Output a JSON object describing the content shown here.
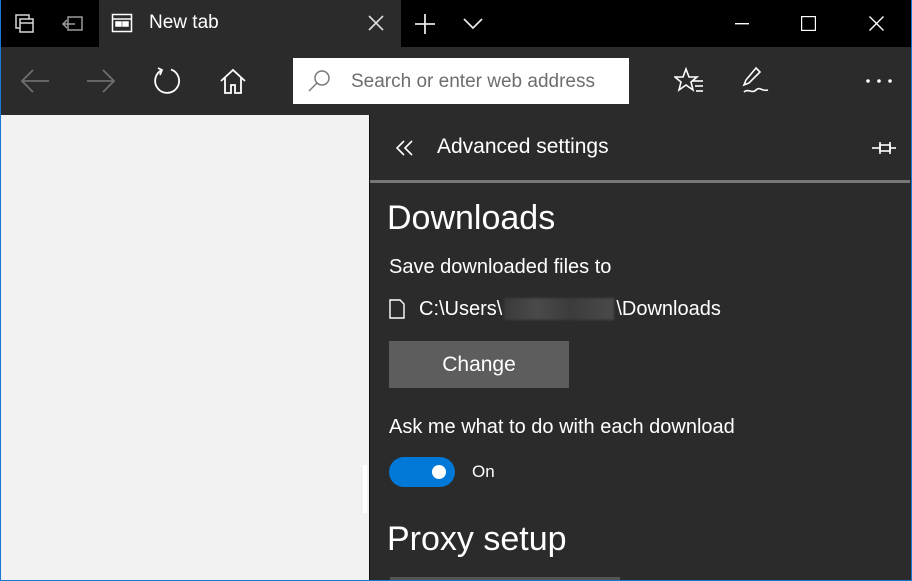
{
  "titlebar": {
    "tab_title": "New tab",
    "icons": [
      "tab-preview-icon",
      "set-aside-tabs-icon",
      "tab-favicon-icon",
      "close-tab-icon",
      "new-tab-icon",
      "tab-menu-icon",
      "minimize-icon",
      "maximize-icon",
      "close-window-icon"
    ]
  },
  "navbar": {
    "search_placeholder": "Search or enter web address",
    "icons": [
      "back-icon",
      "forward-icon",
      "refresh-icon",
      "home-icon",
      "search-icon",
      "favorites-icon",
      "web-note-icon",
      "more-icon"
    ]
  },
  "panel": {
    "title": "Advanced settings",
    "downloads": {
      "heading": "Downloads",
      "save_label": "Save downloaded files to",
      "path_prefix": "C:\\Users\\",
      "path_suffix": "\\Downloads",
      "change_button": "Change",
      "ask_label": "Ask me what to do with each download",
      "toggle_state": "On"
    },
    "proxy": {
      "heading": "Proxy setup"
    }
  },
  "colors": {
    "accent": "#0078d7",
    "window_border": "#1778d4",
    "panel_bg": "#2b2b2b",
    "button_bg": "#5d5d5d",
    "page_bg": "#f2f2f2"
  }
}
